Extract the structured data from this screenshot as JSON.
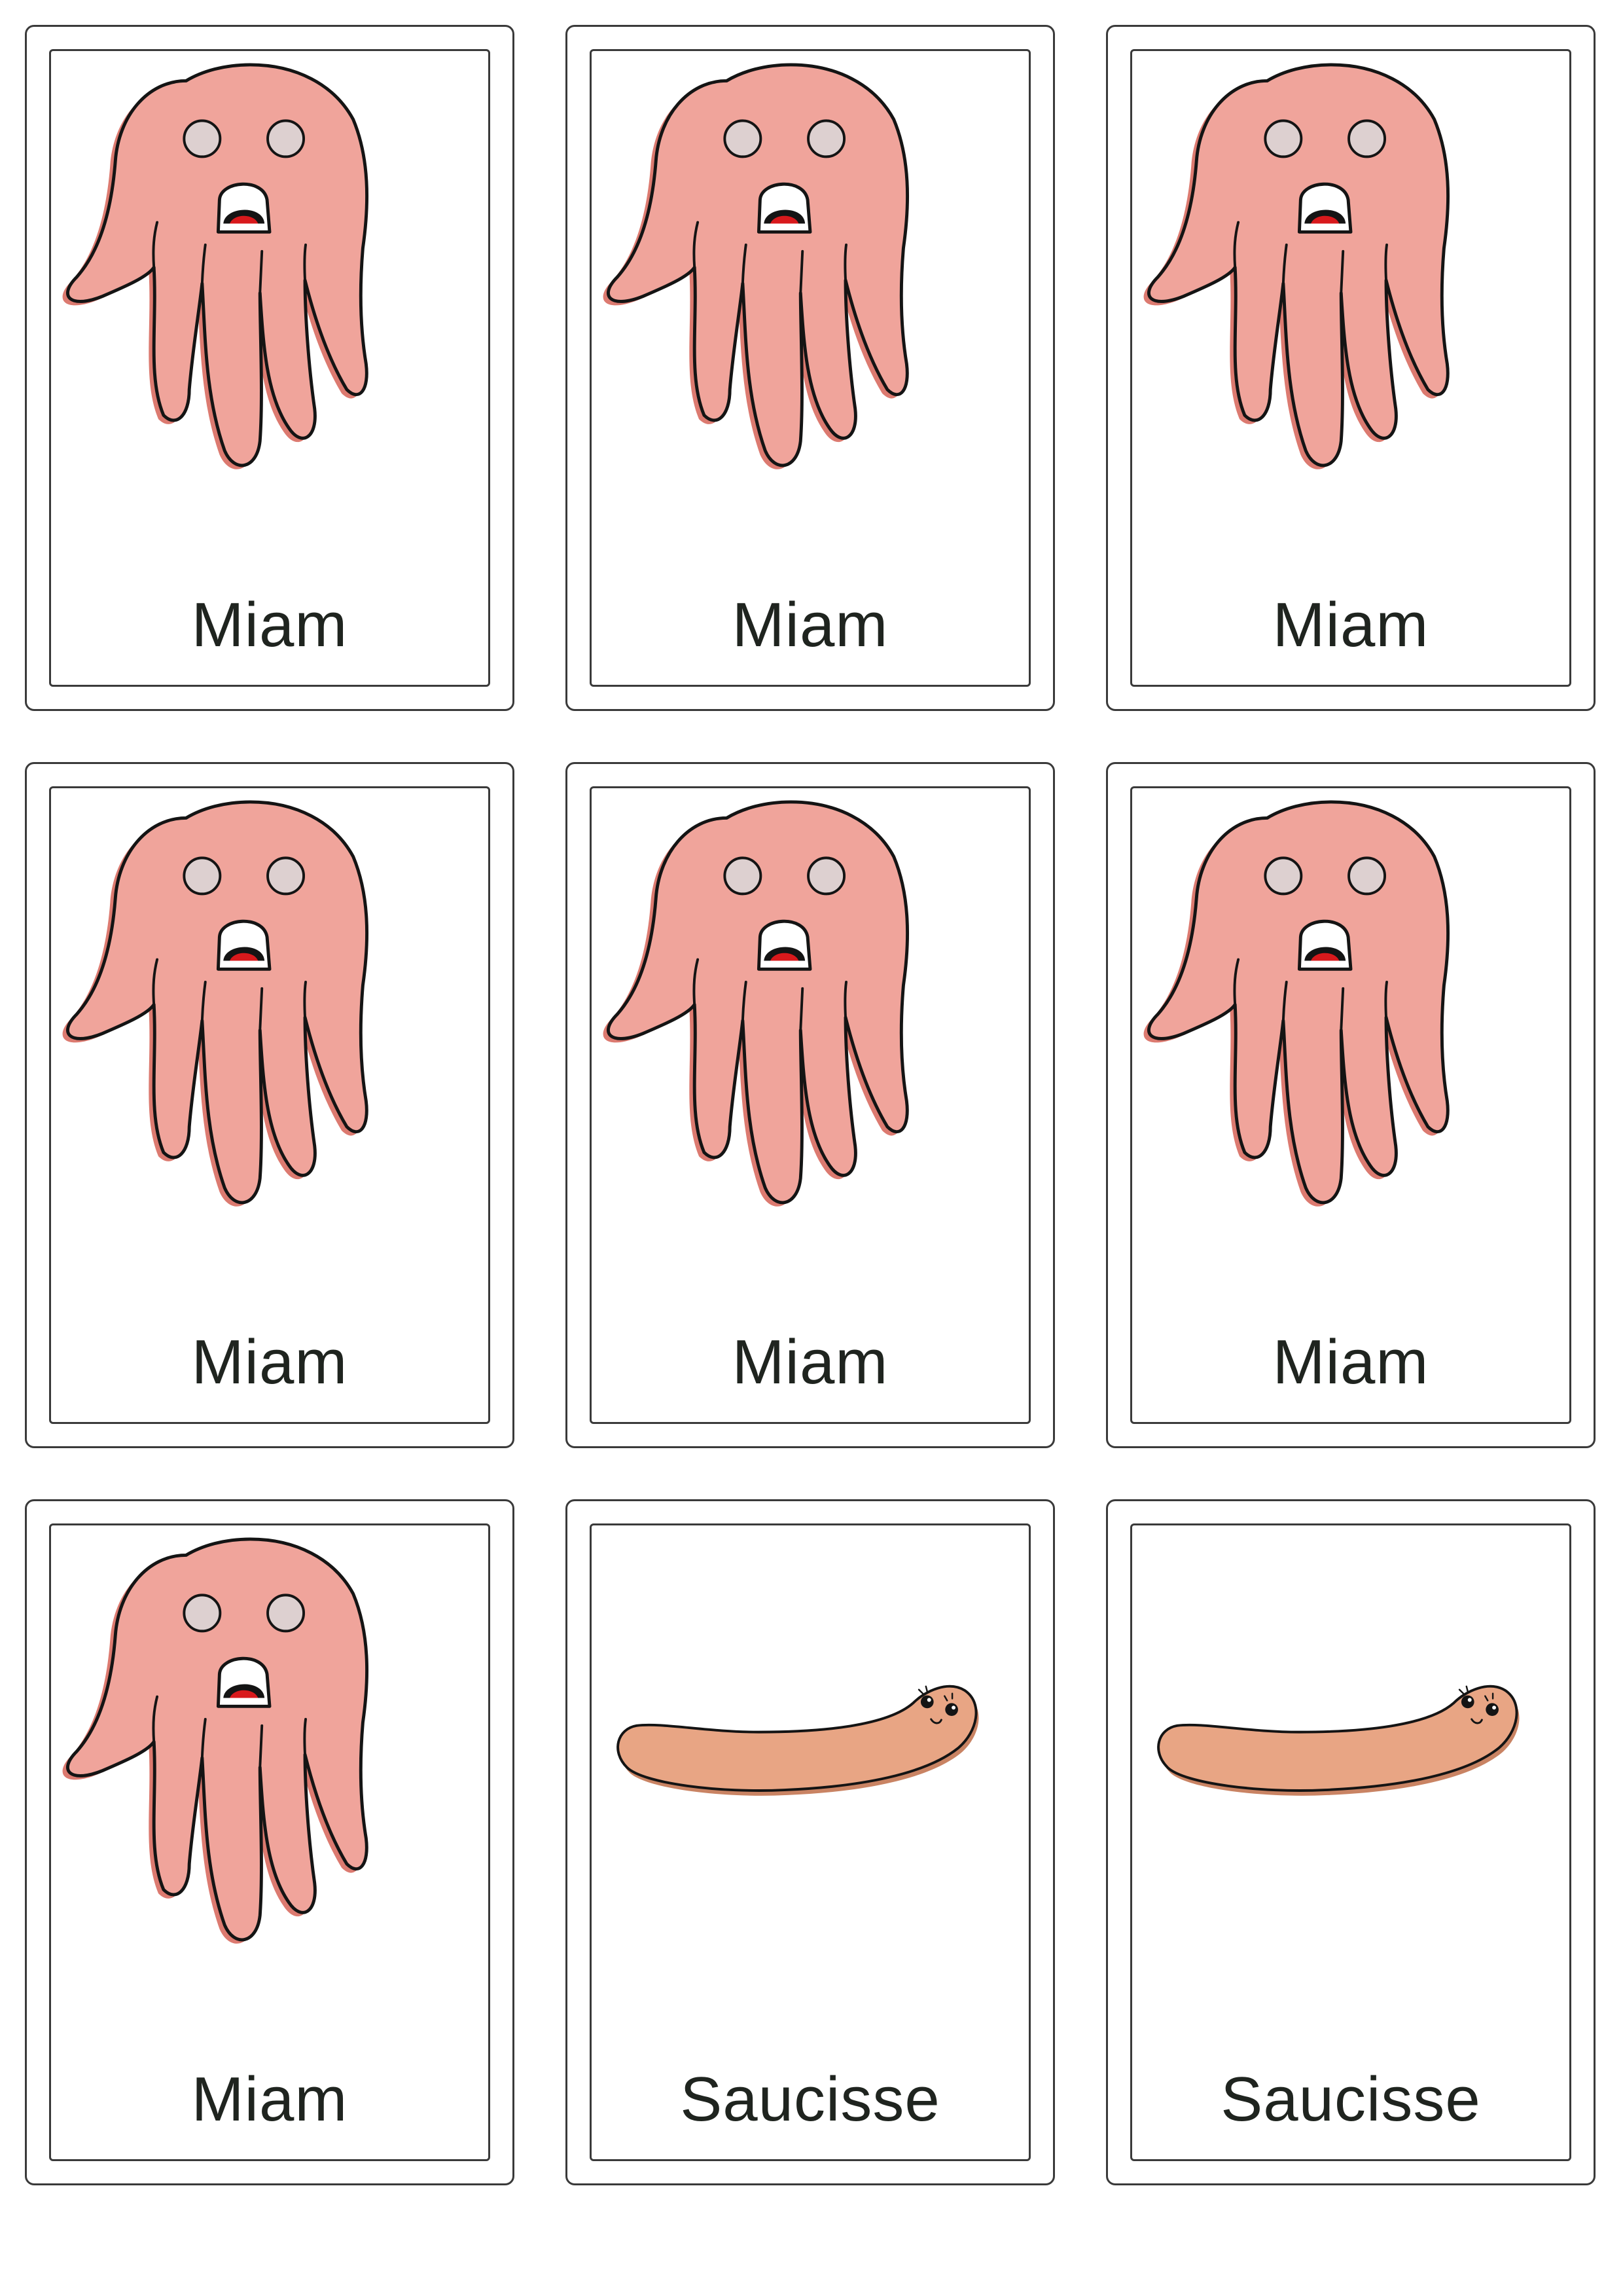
{
  "cards": [
    {
      "label": "Miam",
      "illustration": "octopus-icon"
    },
    {
      "label": "Miam",
      "illustration": "octopus-icon"
    },
    {
      "label": "Miam",
      "illustration": "octopus-icon"
    },
    {
      "label": "Miam",
      "illustration": "octopus-icon"
    },
    {
      "label": "Miam",
      "illustration": "octopus-icon"
    },
    {
      "label": "Miam",
      "illustration": "octopus-icon"
    },
    {
      "label": "Miam",
      "illustration": "octopus-icon"
    },
    {
      "label": "Saucisse",
      "illustration": "sausage-icon"
    },
    {
      "label": "Saucisse",
      "illustration": "sausage-icon"
    }
  ],
  "colors": {
    "octopus_body": "#f0a49b",
    "octopus_shadow": "#dc7a70",
    "sausage_body": "#e8a584",
    "sausage_shadow": "#c98363",
    "outline": "#141414",
    "mouth_red": "#d8191c"
  }
}
